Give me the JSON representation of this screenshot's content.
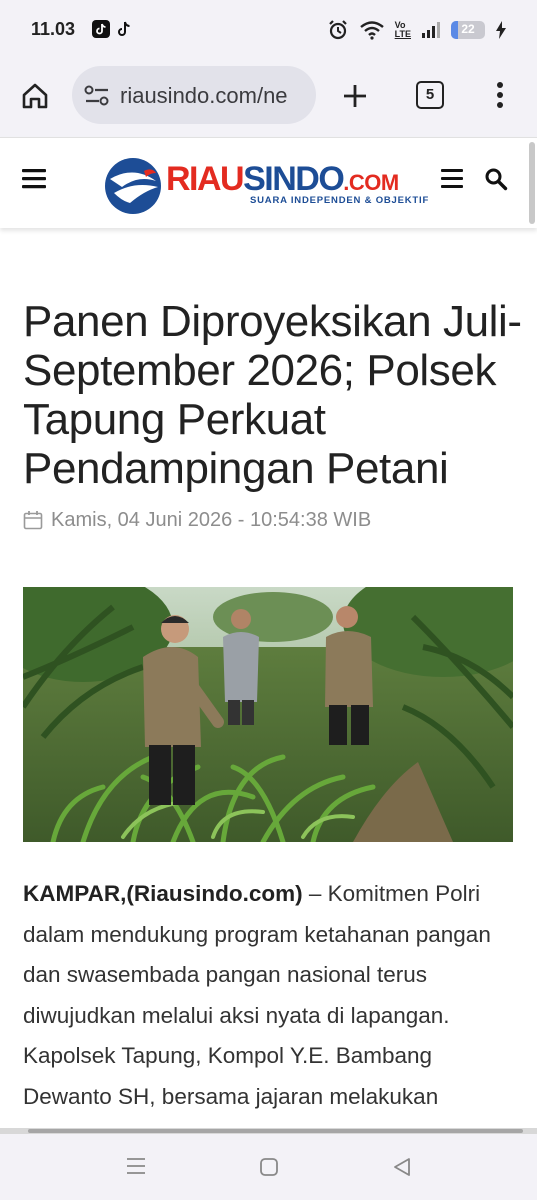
{
  "status_bar": {
    "time": "11.03",
    "battery_level": "22",
    "battery_fraction": 0.22,
    "network_label_top": "Vo",
    "network_label_bottom": "LTE",
    "icons": [
      "tiktok-app-icon",
      "tiktok-icon",
      "alarm-icon",
      "wifi-icon",
      "volte-icon",
      "signal-icon",
      "battery-icon",
      "charging-icon"
    ]
  },
  "browser": {
    "url": "riausindo.com/ne",
    "tab_count": "5",
    "icons": [
      "home-icon",
      "site-settings-icon",
      "new-tab-icon",
      "tabs-icon",
      "more-vert-icon"
    ]
  },
  "site": {
    "logo_part1": "RIAU",
    "logo_part2": "SINDO",
    "logo_part3": ".COM",
    "tagline": "SUARA INDEPENDEN & OBJEKTIF",
    "colors": {
      "red": "#e32b20",
      "blue": "#1d4d96"
    },
    "icons": [
      "hamburger-menu-icon",
      "logo-emblem-icon",
      "secondary-menu-icon",
      "search-icon"
    ]
  },
  "article": {
    "title": "Panen Diproyeksikan Juli-September 2026; Polsek Tapung Perkuat Pendampingan Petani",
    "date": "Kamis, 04 Juni 2026 - 10:54:38 WIB",
    "dateline": "KAMPAR,(Riausindo.com)",
    "body": " – Komitmen Polri dalam mendukung program ketahanan pangan dan swasembada pangan nasional terus diwujudkan melalui aksi nyata di lapangan. Kapolsek Tapung, Kompol Y.E. Bambang Dewanto SH, bersama jajaran melakukan",
    "image_icon": "photo-officers-cornfield"
  },
  "nav_bar": {
    "icons": [
      "recents-icon",
      "home-circle-icon",
      "back-icon"
    ]
  }
}
